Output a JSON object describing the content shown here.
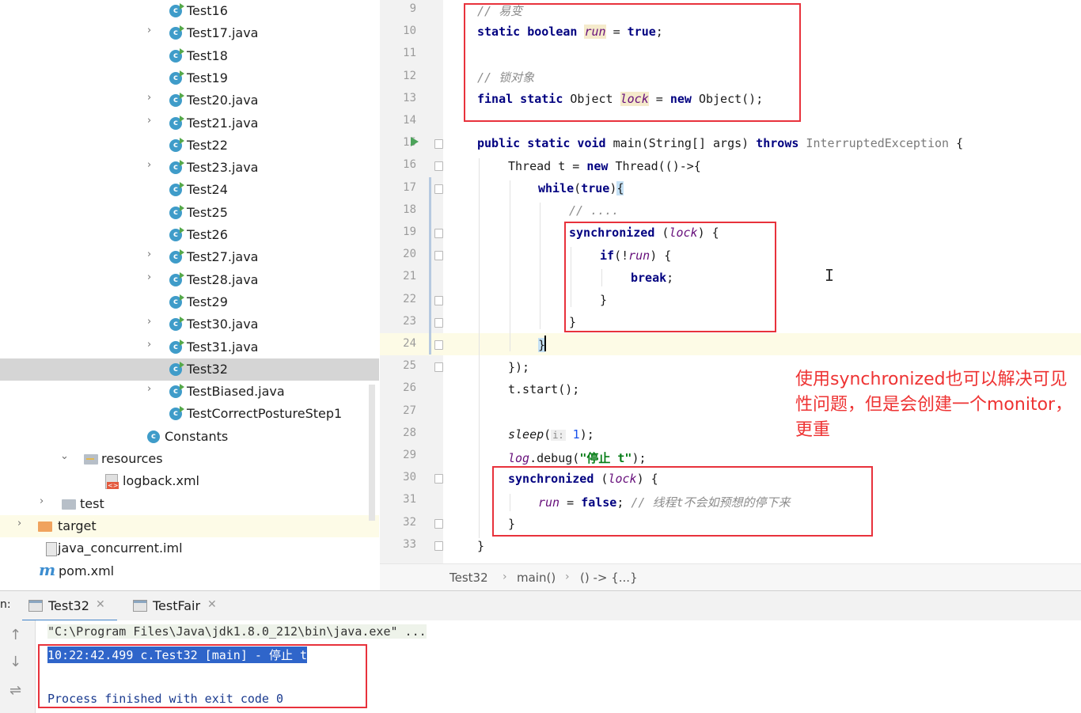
{
  "tree": {
    "items": [
      {
        "label": "Test16",
        "expand": "",
        "icon": "class-run"
      },
      {
        "label": "Test17.java",
        "expand": "›",
        "icon": "class-run"
      },
      {
        "label": "Test18",
        "expand": "",
        "icon": "class-run"
      },
      {
        "label": "Test19",
        "expand": "",
        "icon": "class-run"
      },
      {
        "label": "Test20.java",
        "expand": "›",
        "icon": "class-run"
      },
      {
        "label": "Test21.java",
        "expand": "›",
        "icon": "class-run"
      },
      {
        "label": "Test22",
        "expand": "",
        "icon": "class-run"
      },
      {
        "label": "Test23.java",
        "expand": "›",
        "icon": "class-run"
      },
      {
        "label": "Test24",
        "expand": "",
        "icon": "class-run"
      },
      {
        "label": "Test25",
        "expand": "",
        "icon": "class-run"
      },
      {
        "label": "Test26",
        "expand": "",
        "icon": "class-run"
      },
      {
        "label": "Test27.java",
        "expand": "›",
        "icon": "class-run"
      },
      {
        "label": "Test28.java",
        "expand": "›",
        "icon": "class-run"
      },
      {
        "label": "Test29",
        "expand": "",
        "icon": "class-run"
      },
      {
        "label": "Test30.java",
        "expand": "›",
        "icon": "class-run"
      },
      {
        "label": "Test31.java",
        "expand": "›",
        "icon": "class-run"
      },
      {
        "label": "Test32",
        "expand": "",
        "icon": "class-run",
        "selected": true
      },
      {
        "label": "TestBiased.java",
        "expand": "›",
        "icon": "class-run"
      },
      {
        "label": "TestCorrectPostureStep1",
        "expand": "",
        "icon": "class-run"
      },
      {
        "label": "Constants",
        "expand": "",
        "icon": "class"
      },
      {
        "label": "resources",
        "expand": "⌄",
        "icon": "resources-folder"
      },
      {
        "label": "logback.xml",
        "expand": "",
        "icon": "xml-file"
      },
      {
        "label": "test",
        "expand": "›",
        "icon": "folder"
      },
      {
        "label": "target",
        "expand": "›",
        "icon": "orange-folder"
      },
      {
        "label": "java_concurrent.iml",
        "expand": "",
        "icon": "iml-file"
      },
      {
        "label": "pom.xml",
        "expand": "",
        "icon": "maven-file"
      }
    ]
  },
  "editor": {
    "line_numbers": [
      "9",
      "10",
      "11",
      "12",
      "13",
      "14",
      "15",
      "16",
      "17",
      "18",
      "19",
      "20",
      "21",
      "22",
      "23",
      "24",
      "25",
      "26",
      "27",
      "28",
      "29",
      "30",
      "31",
      "32",
      "33"
    ],
    "code": {
      "l9": "// 易变",
      "l10_kw": "static boolean",
      "l10_var": "run",
      "l10_eq": " = ",
      "l10_val": "true",
      "l10_end": ";",
      "l12": "// 锁对象",
      "l13_kw": "final static",
      "l13_type": " Object ",
      "l13_var": "lock",
      "l13_eq": " = ",
      "l13_new": "new",
      "l13_end": " Object();",
      "l15_kw": "public static void",
      "l15_sig": " main(String[] args) ",
      "l15_throws": "throws",
      "l15_exc": " InterruptedException",
      "l15_end": " {",
      "l16_a": "Thread t = ",
      "l16_new": "new",
      "l16_b": " Thread(()->{",
      "l17_kw": "while",
      "l17_p": "(",
      "l17_true": "true",
      "l17_close": ")",
      "l17_brace": "{",
      "l18": "// ....",
      "l19_kw": "synchronized",
      "l19_p": " (",
      "l19_var": "lock",
      "l19_end": ") {",
      "l20_kw": "if",
      "l20_p": "(!",
      "l20_var": "run",
      "l20_end": ") {",
      "l21_kw": "break",
      "l21_end": ";",
      "l22": "}",
      "l23": "}",
      "l24": "}",
      "l25": "});",
      "l26": "t.start();",
      "l28_m": "sleep",
      "l28_p": "(",
      "l28_hint": "i:",
      "l28_num": "1",
      "l28_end": ");",
      "l29_log": "log",
      "l29_m": ".debug(",
      "l29_str": "\"停止 t\"",
      "l29_end": ");",
      "l30_kw": "synchronized",
      "l30_p": " (",
      "l30_var": "lock",
      "l30_end": ") {",
      "l31_var": "run",
      "l31_eq": " = ",
      "l31_val": "false",
      "l31_semi": ";",
      "l31_cm": " // 线程t不会如预想的停下来",
      "l32": "}",
      "l33": "}"
    },
    "annotation": "使用synchronized也可以解决可见性问题，但是会创建一个monitor，更重"
  },
  "breadcrumb": [
    "Test32",
    "main()",
    "() -> {...}"
  ],
  "run_panel": {
    "label_prefix": "n:",
    "tabs": [
      {
        "label": "Test32",
        "active": true
      },
      {
        "label": "TestFair",
        "active": false
      }
    ],
    "console": {
      "command": "\"C:\\Program Files\\Java\\jdk1.8.0_212\\bin\\java.exe\" ...",
      "log_line": "10:22:42.499 c.Test32 [main] - 停止 t",
      "exit": "Process finished with exit code 0"
    }
  },
  "colors": {
    "keyword": "#000080",
    "field": "#660e7a",
    "string": "#067d17",
    "comment": "#8c8c8c",
    "highlight_box": "#e8323c",
    "annotation": "#ee3333",
    "selection": "#2f65ca"
  }
}
